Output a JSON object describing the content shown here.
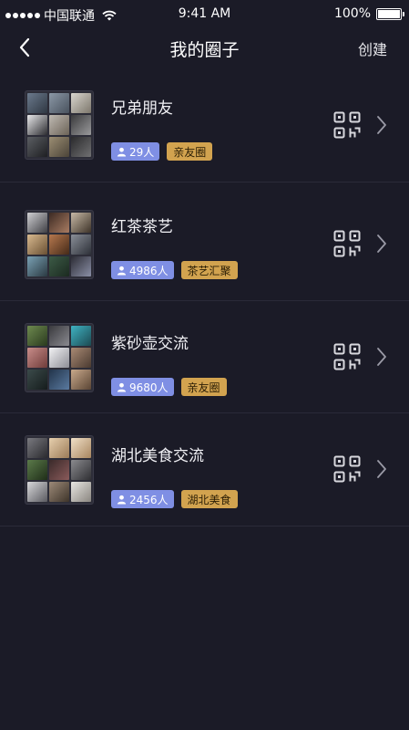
{
  "status_bar": {
    "carrier": "中国联通",
    "time": "9:41 AM",
    "battery": "100%"
  },
  "nav": {
    "title": "我的圈子",
    "create_label": "创建",
    "back_icon": "chevron-left-icon"
  },
  "circles": [
    {
      "name": "兄弟朋友",
      "members": "29人",
      "tag": "亲友圈"
    },
    {
      "name": "红茶茶艺",
      "members": "4986人",
      "tag": "茶艺汇聚"
    },
    {
      "name": "紫砂壶交流",
      "members": "9680人",
      "tag": "亲友圈"
    },
    {
      "name": "湖北美食交流",
      "members": "2456人",
      "tag": "湖北美食"
    }
  ],
  "colors": {
    "background": "#1b1b27",
    "member_badge": "#7f8fe4",
    "type_badge": "#d2a34f",
    "divider": "#2a2a38"
  },
  "icons": {
    "member": "person-icon",
    "qr": "qr-code-icon",
    "row_arrow": "chevron-right-icon"
  }
}
